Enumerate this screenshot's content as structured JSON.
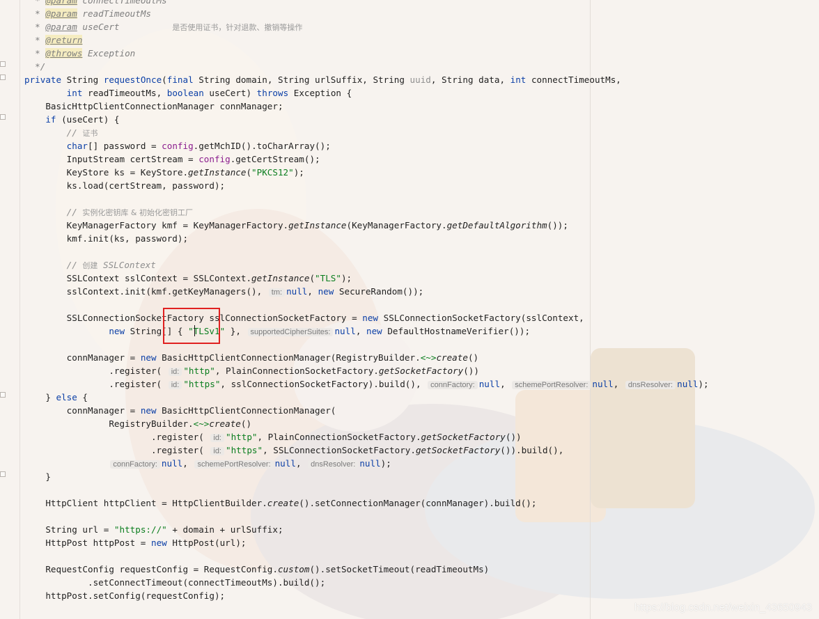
{
  "watermark": "https://blog.csdn.net/weixin_43650943",
  "lines": [
    {
      "tokens": [
        {
          "t": "  * ",
          "c": "doc"
        },
        {
          "t": "@param",
          "c": "tag"
        },
        {
          "t": " connectTimeoutMs",
          "c": "doc"
        }
      ]
    },
    {
      "tokens": [
        {
          "t": "  * ",
          "c": "doc"
        },
        {
          "t": "@param",
          "c": "tag"
        },
        {
          "t": " readTimeoutMs",
          "c": "doc"
        }
      ]
    },
    {
      "tokens": [
        {
          "t": "  * ",
          "c": "doc"
        },
        {
          "t": "@param",
          "c": "tagplain"
        },
        {
          "t": " useCert          ",
          "c": "doc"
        },
        {
          "t": "是否使用证书，针对退款、撤销等操作",
          "c": "cjk"
        }
      ]
    },
    {
      "tokens": [
        {
          "t": "  * ",
          "c": "doc"
        },
        {
          "t": "@return",
          "c": "tag"
        }
      ]
    },
    {
      "tokens": [
        {
          "t": "  * ",
          "c": "doc"
        },
        {
          "t": "@throws",
          "c": "tag"
        },
        {
          "t": " Exception",
          "c": "doc"
        }
      ]
    },
    {
      "tokens": [
        {
          "t": "  */",
          "c": "doc"
        }
      ]
    },
    {
      "tokens": [
        {
          "t": "private ",
          "c": "kw"
        },
        {
          "t": "String ",
          "c": ""
        },
        {
          "t": "requestOnce",
          "c": "kw"
        },
        {
          "t": "(",
          "c": ""
        },
        {
          "t": "final ",
          "c": "kw"
        },
        {
          "t": "String domain, String urlSuffix, String ",
          "c": ""
        },
        {
          "t": "uuid",
          "c": "unused"
        },
        {
          "t": ", String data, ",
          "c": ""
        },
        {
          "t": "int ",
          "c": "kw"
        },
        {
          "t": "connectTimeoutMs,",
          "c": ""
        }
      ]
    },
    {
      "tokens": [
        {
          "t": "        ",
          "c": ""
        },
        {
          "t": "int ",
          "c": "kw"
        },
        {
          "t": "readTimeoutMs, ",
          "c": ""
        },
        {
          "t": "boolean ",
          "c": "kw"
        },
        {
          "t": "useCert) ",
          "c": ""
        },
        {
          "t": "throws ",
          "c": "kw"
        },
        {
          "t": "Exception {",
          "c": ""
        }
      ]
    },
    {
      "tokens": [
        {
          "t": "    BasicHttpClientConnectionManager connManager;",
          "c": ""
        }
      ]
    },
    {
      "tokens": [
        {
          "t": "    ",
          "c": ""
        },
        {
          "t": "if ",
          "c": "kw"
        },
        {
          "t": "(useCert) {",
          "c": ""
        }
      ]
    },
    {
      "tokens": [
        {
          "t": "        // ",
          "c": "com"
        },
        {
          "t": "证书",
          "c": "cjk"
        }
      ]
    },
    {
      "tokens": [
        {
          "t": "        ",
          "c": ""
        },
        {
          "t": "char",
          "c": "kw"
        },
        {
          "t": "[] password = ",
          "c": ""
        },
        {
          "t": "config",
          "c": "fld"
        },
        {
          "t": ".getMchID().toCharArray();",
          "c": ""
        }
      ]
    },
    {
      "tokens": [
        {
          "t": "        InputStream certStream = ",
          "c": ""
        },
        {
          "t": "config",
          "c": "fld"
        },
        {
          "t": ".getCertStream();",
          "c": ""
        }
      ]
    },
    {
      "tokens": [
        {
          "t": "        KeyStore ks = KeyStore.",
          "c": ""
        },
        {
          "t": "getInstance",
          "c": "it"
        },
        {
          "t": "(",
          "c": ""
        },
        {
          "t": "\"PKCS12\"",
          "c": "str"
        },
        {
          "t": ");",
          "c": ""
        }
      ]
    },
    {
      "tokens": [
        {
          "t": "        ks.load(certStream, password);",
          "c": ""
        }
      ]
    },
    {
      "tokens": []
    },
    {
      "tokens": [
        {
          "t": "        // ",
          "c": "com"
        },
        {
          "t": "实例化密钥库 & 初始化密钥工厂",
          "c": "cjk"
        }
      ]
    },
    {
      "tokens": [
        {
          "t": "        KeyManagerFactory kmf = KeyManagerFactory.",
          "c": ""
        },
        {
          "t": "getInstance",
          "c": "it"
        },
        {
          "t": "(KeyManagerFactory.",
          "c": ""
        },
        {
          "t": "getDefaultAlgorithm",
          "c": "it"
        },
        {
          "t": "());",
          "c": ""
        }
      ]
    },
    {
      "tokens": [
        {
          "t": "        kmf.init(ks, password);",
          "c": ""
        }
      ]
    },
    {
      "tokens": []
    },
    {
      "tokens": [
        {
          "t": "        // ",
          "c": "com"
        },
        {
          "t": "创建",
          "c": "cjk"
        },
        {
          "t": " SSLContext",
          "c": "com"
        }
      ]
    },
    {
      "tokens": [
        {
          "t": "        SSLContext sslContext = SSLContext.",
          "c": ""
        },
        {
          "t": "getInstance",
          "c": "it"
        },
        {
          "t": "(",
          "c": ""
        },
        {
          "t": "\"TLS\"",
          "c": "str"
        },
        {
          "t": ");",
          "c": ""
        }
      ]
    },
    {
      "tokens": [
        {
          "t": "        sslContext.init(kmf.getKeyManagers(), ",
          "c": ""
        },
        {
          "t": "tm:",
          "c": "hint"
        },
        {
          "t": "null",
          "c": "kw"
        },
        {
          "t": ", ",
          "c": ""
        },
        {
          "t": "new ",
          "c": "kw"
        },
        {
          "t": "SecureRandom());",
          "c": ""
        }
      ]
    },
    {
      "tokens": []
    },
    {
      "tokens": [
        {
          "t": "        SSLConnectionSocketFactory sslConnectionSocketFactory = ",
          "c": ""
        },
        {
          "t": "new ",
          "c": "kw"
        },
        {
          "t": "SSLConnectionSocketFactory(sslContext,",
          "c": ""
        }
      ]
    },
    {
      "tokens": [
        {
          "t": "                ",
          "c": ""
        },
        {
          "t": "new ",
          "c": "kw"
        },
        {
          "t": "String[] { ",
          "c": ""
        },
        {
          "t": "\"TLSv1\"",
          "c": "str"
        },
        {
          "t": " }, ",
          "c": ""
        },
        {
          "t": "supportedCipherSuites:",
          "c": "hint"
        },
        {
          "t": "null",
          "c": "kw"
        },
        {
          "t": ", ",
          "c": ""
        },
        {
          "t": "new ",
          "c": "kw"
        },
        {
          "t": "DefaultHostnameVerifier());",
          "c": ""
        }
      ]
    },
    {
      "tokens": []
    },
    {
      "tokens": [
        {
          "t": "        connManager = ",
          "c": ""
        },
        {
          "t": "new ",
          "c": "kw"
        },
        {
          "t": "BasicHttpClientConnectionManager(RegistryBuilder.",
          "c": ""
        },
        {
          "t": "<~>",
          "c": "str"
        },
        {
          "t": "create",
          "c": "it"
        },
        {
          "t": "()",
          "c": ""
        }
      ]
    },
    {
      "tokens": [
        {
          "t": "                .register( ",
          "c": ""
        },
        {
          "t": "id:",
          "c": "hint"
        },
        {
          "t": "\"http\"",
          "c": "str"
        },
        {
          "t": ", PlainConnectionSocketFactory.",
          "c": ""
        },
        {
          "t": "getSocketFactory",
          "c": "it"
        },
        {
          "t": "())",
          "c": ""
        }
      ]
    },
    {
      "tokens": [
        {
          "t": "                .register( ",
          "c": ""
        },
        {
          "t": "id:",
          "c": "hint"
        },
        {
          "t": "\"https\"",
          "c": "str"
        },
        {
          "t": ", sslConnectionSocketFactory).build(), ",
          "c": ""
        },
        {
          "t": "connFactory:",
          "c": "hint"
        },
        {
          "t": "null",
          "c": "kw"
        },
        {
          "t": ", ",
          "c": ""
        },
        {
          "t": "schemePortResolver:",
          "c": "hint"
        },
        {
          "t": "null",
          "c": "kw"
        },
        {
          "t": ", ",
          "c": ""
        },
        {
          "t": "dnsResolver:",
          "c": "hint"
        },
        {
          "t": "null",
          "c": "kw"
        },
        {
          "t": ");",
          "c": ""
        }
      ]
    },
    {
      "tokens": [
        {
          "t": "    } ",
          "c": ""
        },
        {
          "t": "else ",
          "c": "kw"
        },
        {
          "t": "{",
          "c": ""
        }
      ]
    },
    {
      "tokens": [
        {
          "t": "        connManager = ",
          "c": ""
        },
        {
          "t": "new ",
          "c": "kw"
        },
        {
          "t": "BasicHttpClientConnectionManager(",
          "c": ""
        }
      ]
    },
    {
      "tokens": [
        {
          "t": "                RegistryBuilder.",
          "c": ""
        },
        {
          "t": "<~>",
          "c": "str"
        },
        {
          "t": "create",
          "c": "it"
        },
        {
          "t": "()",
          "c": ""
        }
      ]
    },
    {
      "tokens": [
        {
          "t": "                        .register( ",
          "c": ""
        },
        {
          "t": "id:",
          "c": "hint"
        },
        {
          "t": "\"http\"",
          "c": "str"
        },
        {
          "t": ", PlainConnectionSocketFactory.",
          "c": ""
        },
        {
          "t": "getSocketFactory",
          "c": "it"
        },
        {
          "t": "())",
          "c": ""
        }
      ]
    },
    {
      "tokens": [
        {
          "t": "                        .register( ",
          "c": ""
        },
        {
          "t": "id:",
          "c": "hint"
        },
        {
          "t": "\"https\"",
          "c": "str"
        },
        {
          "t": ", SSLConnectionSocketFactory.",
          "c": ""
        },
        {
          "t": "getSocketFactory",
          "c": "it"
        },
        {
          "t": "()).build(),",
          "c": ""
        }
      ]
    },
    {
      "tokens": [
        {
          "t": "                ",
          "c": ""
        },
        {
          "t": "connFactory:",
          "c": "hint"
        },
        {
          "t": "null",
          "c": "kw"
        },
        {
          "t": ", ",
          "c": ""
        },
        {
          "t": "schemePortResolver:",
          "c": "hint"
        },
        {
          "t": "null",
          "c": "kw"
        },
        {
          "t": ", ",
          "c": ""
        },
        {
          "t": "dnsResolver:",
          "c": "hint"
        },
        {
          "t": "null",
          "c": "kw"
        },
        {
          "t": ");",
          "c": ""
        }
      ]
    },
    {
      "tokens": [
        {
          "t": "    }",
          "c": ""
        }
      ]
    },
    {
      "tokens": []
    },
    {
      "tokens": [
        {
          "t": "    HttpClient httpClient = HttpClientBuilder.",
          "c": ""
        },
        {
          "t": "create",
          "c": "it"
        },
        {
          "t": "().setConnectionManager(connManager).build();",
          "c": ""
        }
      ]
    },
    {
      "tokens": []
    },
    {
      "tokens": [
        {
          "t": "    String url = ",
          "c": ""
        },
        {
          "t": "\"https://\"",
          "c": "str"
        },
        {
          "t": " + domain + urlSuffix;",
          "c": ""
        }
      ]
    },
    {
      "tokens": [
        {
          "t": "    HttpPost httpPost = ",
          "c": ""
        },
        {
          "t": "new ",
          "c": "kw"
        },
        {
          "t": "HttpPost(url);",
          "c": ""
        }
      ]
    },
    {
      "tokens": []
    },
    {
      "tokens": [
        {
          "t": "    RequestConfig requestConfig = RequestConfig.",
          "c": ""
        },
        {
          "t": "custom",
          "c": "it"
        },
        {
          "t": "().setSocketTimeout(readTimeoutMs)",
          "c": ""
        }
      ]
    },
    {
      "tokens": [
        {
          "t": "            .setConnectTimeout(connectTimeoutMs).build();",
          "c": ""
        }
      ]
    },
    {
      "tokens": [
        {
          "t": "    httpPost.setConfig(requestConfig);",
          "c": ""
        }
      ]
    }
  ]
}
